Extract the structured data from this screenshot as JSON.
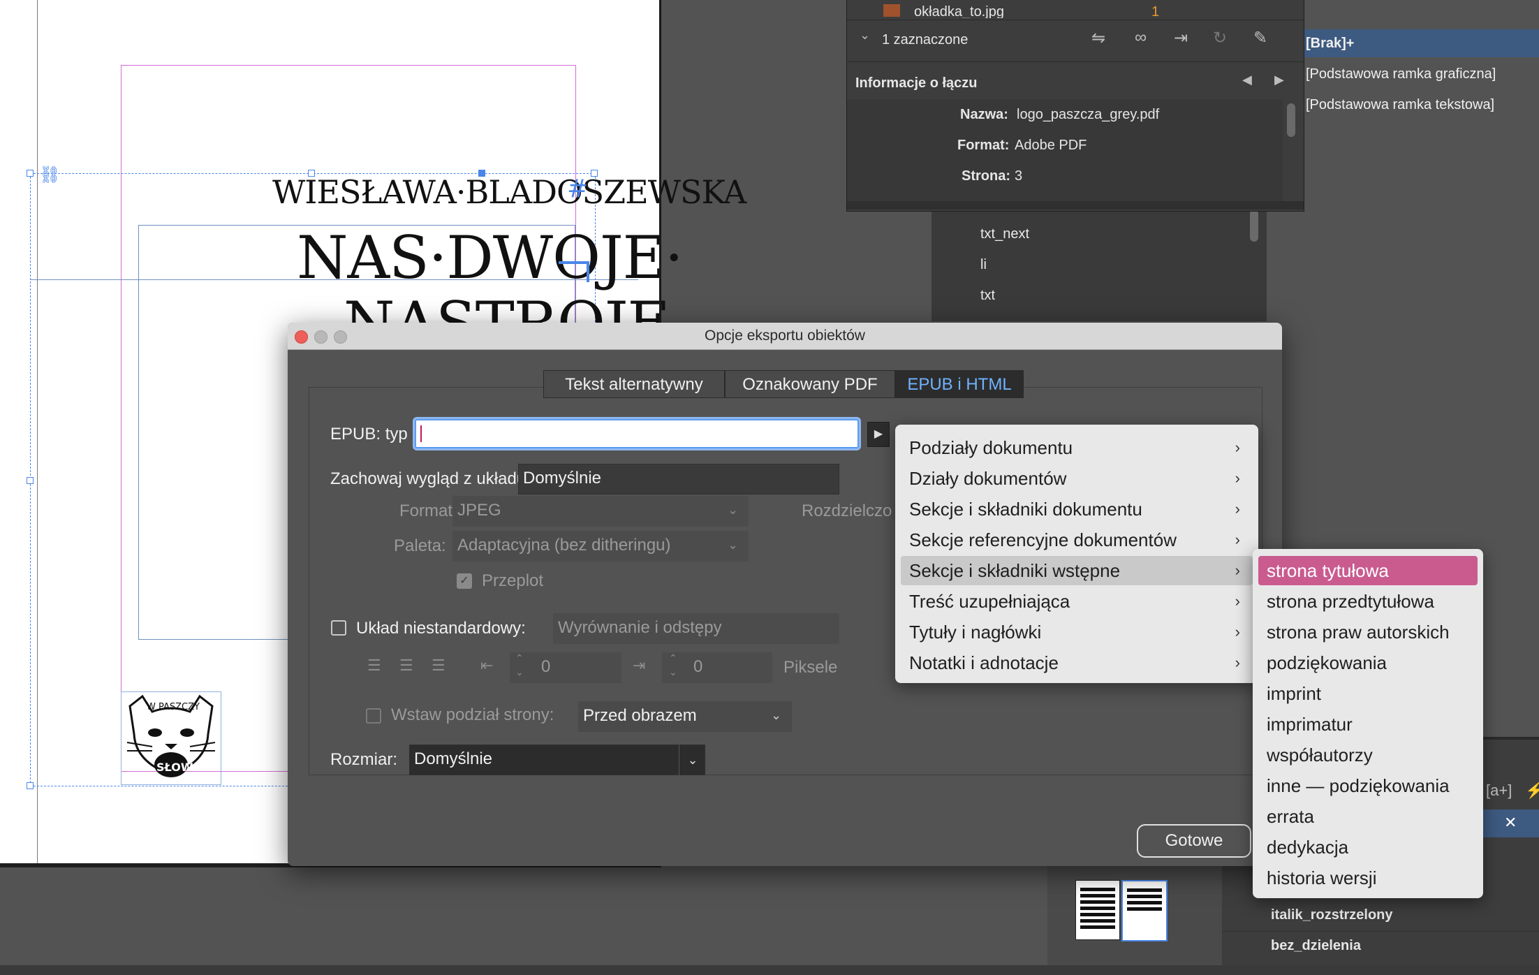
{
  "document": {
    "author": "WIESŁAWA·BLADOSZEWSKA",
    "title_line1": "NAS·DWOJE·",
    "title_line2": "NASTROJE",
    "logo_top_text": "W PASZCZY",
    "logo_bottom_text": "SŁOW"
  },
  "links_panel": {
    "file_partial": "okładka_to.jpg",
    "file_count": "1",
    "selected_count": "1 zaznaczone",
    "info_header": "Informacje o łączu",
    "name_label": "Nazwa:",
    "name_value": "logo_paszcza_grey.pdf",
    "format_label": "Format:",
    "format_value": "Adobe PDF",
    "page_label": "Strona:",
    "page_value": "3"
  },
  "tags_panel": {
    "items": [
      "txt_next",
      "li",
      "txt"
    ]
  },
  "object_styles": {
    "items": [
      "[Brak]+",
      "[Podstawowa ramka graficzna]",
      "[Podstawowa ramka tekstowa]"
    ]
  },
  "bottom_styles": {
    "items": [
      "italik_rozstrzelony",
      "bez_dzielenia"
    ],
    "ai_label": "[a+]"
  },
  "dialog": {
    "title": "Opcje eksportu obiektów",
    "tabs": [
      "Tekst alternatywny",
      "Oznakowany PDF",
      "EPUB i HTML"
    ],
    "epub_type_label": "EPUB: typ",
    "epub_type_value": "",
    "preserve_label": "Zachowaj wygląd z układu",
    "preserve_value": "Domyślnie",
    "format_label": "Format:",
    "format_value": "JPEG",
    "resolution_label": "Rozdzielczo",
    "palette_label": "Paleta:",
    "palette_value": "Adaptacyjna (bez ditheringu)",
    "interlace_label": "Przeplot",
    "custom_layout_label": "Układ niestandardowy:",
    "custom_layout_value": "Wyrównanie i odstępy",
    "spacing_before": "0",
    "spacing_after": "0",
    "spacing_unit": "Piksele",
    "page_break_label": "Wstaw podział strony:",
    "page_break_value": "Przed obrazem",
    "size_label": "Rozmiar:",
    "size_value": "Domyślnie",
    "done_label": "Gotowe"
  },
  "menu_categories": [
    "Podziały dokumentu",
    "Działy dokumentów",
    "Sekcje i składniki dokumentu",
    "Sekcje referencyjne dokumentów",
    "Sekcje i składniki wstępne",
    "Treść uzupełniająca",
    "Tytuły i nagłówki",
    "Notatki i adnotacje"
  ],
  "menu_front_matter": [
    "strona tytułowa",
    "strona przedtytułowa",
    "strona praw autorskich",
    "podziękowania",
    "imprint",
    "imprimatur",
    "współautorzy",
    "inne — podziękowania",
    "errata",
    "dedykacja",
    "historia wersji"
  ],
  "colors": {
    "selection_pink": "#c95b8f",
    "tab_active_blue": "#6fb3ff",
    "frame_magenta": "#d46bd4",
    "guide_blue": "#4a86e8"
  }
}
